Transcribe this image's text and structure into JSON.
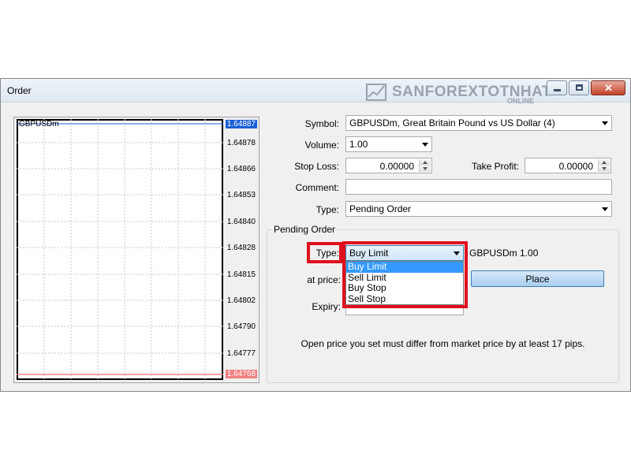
{
  "window": {
    "title": "Order"
  },
  "watermark": {
    "brand": "SANFOREXTOTNHAT",
    "sub": "ONLINE"
  },
  "chart": {
    "symbol": "GBPUSDm",
    "price_ticks": [
      "1.64887",
      "1.64878",
      "1.64866",
      "1.64853",
      "1.64840",
      "1.64828",
      "1.64815",
      "1.64802",
      "1.64790",
      "1.64777",
      "1.64768"
    ],
    "ask_line_color": "#1a5fd6",
    "bid_line_color": "#f08080"
  },
  "form": {
    "symbol_label": "Symbol:",
    "symbol_value": "GBPUSDm, Great Britain Pound vs US Dollar (4)",
    "volume_label": "Volume:",
    "volume_value": "1.00",
    "stop_loss_label": "Stop Loss:",
    "stop_loss_value": "0.00000",
    "take_profit_label": "Take Profit:",
    "take_profit_value": "0.00000",
    "comment_label": "Comment:",
    "comment_value": "",
    "type_label": "Type:",
    "type_value": "Pending Order"
  },
  "pending": {
    "group_title": "Pending Order",
    "type_label": "Type:",
    "type_value": "Buy Limit",
    "summary": "GBPUSDm 1.00",
    "at_price_label": "at price:",
    "expiry_label": "Expiry:",
    "place_label": "Place",
    "options": [
      "Buy Limit",
      "Sell Limit",
      "Buy Stop",
      "Sell Stop"
    ],
    "highlight_color": "#e0101e",
    "info": "Open price you set must differ from market price by at least 17 pips."
  }
}
